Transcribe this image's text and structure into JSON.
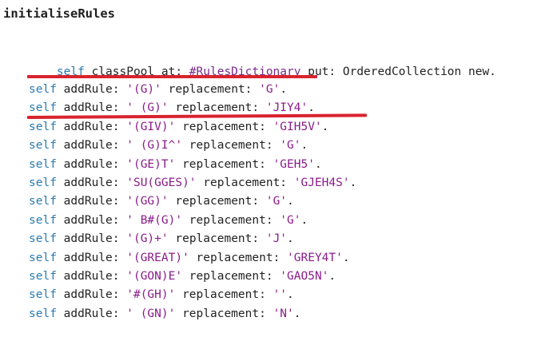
{
  "method": {
    "name": "initialiseRules"
  },
  "colors": {
    "keyword_self": "#2a7ab0",
    "string_literal": "#8a1c8a",
    "symbol_literal": "#7a2a8a",
    "plain_text": "#222222",
    "annotation_underline": "#d9232e"
  },
  "first_statement": {
    "receiver": "self",
    "text_a": " classPool at: ",
    "symbol": "#RulesDictionary",
    "text_b": " put: OrderedCollection new."
  },
  "rules": [
    {
      "receiver": "self",
      "selector_a": " addRule: ",
      "pattern": "'(G)'",
      "selector_b": " replacement: ",
      "replacement": "'G'",
      "terminator": "."
    },
    {
      "receiver": "self",
      "selector_a": " addRule: ",
      "pattern": "' (G)'",
      "selector_b": " replacement: ",
      "replacement": "'JIY4'",
      "terminator": "."
    },
    {
      "receiver": "self",
      "selector_a": " addRule: ",
      "pattern": "'(GIV)'",
      "selector_b": " replacement: ",
      "replacement": "'GIH5V'",
      "terminator": "."
    },
    {
      "receiver": "self",
      "selector_a": " addRule: ",
      "pattern": "' (G)I^'",
      "selector_b": " replacement: ",
      "replacement": "'G'",
      "terminator": "."
    },
    {
      "receiver": "self",
      "selector_a": " addRule: ",
      "pattern": "'(GE)T'",
      "selector_b": " replacement: ",
      "replacement": "'GEH5'",
      "terminator": "."
    },
    {
      "receiver": "self",
      "selector_a": " addRule: ",
      "pattern": "'SU(GGES)'",
      "selector_b": " replacement: ",
      "replacement": "'GJEH4S'",
      "terminator": "."
    },
    {
      "receiver": "self",
      "selector_a": " addRule: ",
      "pattern": "'(GG)'",
      "selector_b": " replacement: ",
      "replacement": "'G'",
      "terminator": "."
    },
    {
      "receiver": "self",
      "selector_a": " addRule: ",
      "pattern": "' B#(G)'",
      "selector_b": " replacement: ",
      "replacement": "'G'",
      "terminator": "."
    },
    {
      "receiver": "self",
      "selector_a": " addRule: ",
      "pattern": "'(G)+'",
      "selector_b": " replacement: ",
      "replacement": "'J'",
      "terminator": "."
    },
    {
      "receiver": "self",
      "selector_a": " addRule: ",
      "pattern": "'(GREAT)'",
      "selector_b": " replacement: ",
      "replacement": "'GREY4T'",
      "terminator": "."
    },
    {
      "receiver": "self",
      "selector_a": " addRule: ",
      "pattern": "'(GON)E'",
      "selector_b": " replacement: ",
      "replacement": "'GAO5N'",
      "terminator": "."
    },
    {
      "receiver": "self",
      "selector_a": " addRule: ",
      "pattern": "'#(GH)'",
      "selector_b": " replacement: ",
      "replacement": "''",
      "terminator": "."
    },
    {
      "receiver": "self",
      "selector_a": " addRule: ",
      "pattern": "' (GN)'",
      "selector_b": " replacement: ",
      "replacement": "'N'",
      "terminator": "."
    }
  ]
}
